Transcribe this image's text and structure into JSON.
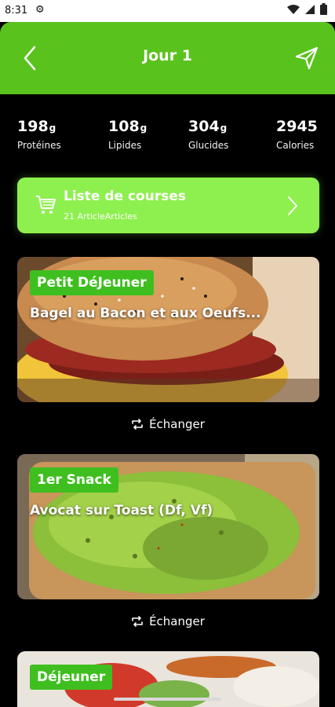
{
  "status": {
    "time": "8:31"
  },
  "header": {
    "title": "Jour 1"
  },
  "macros": [
    {
      "value": "198",
      "unit": "g",
      "label": "Protéines"
    },
    {
      "value": "108",
      "unit": "g",
      "label": "Lipides"
    },
    {
      "value": "304",
      "unit": "g",
      "label": "Glucides"
    },
    {
      "value": "2945",
      "unit": "",
      "label": "Calories"
    }
  ],
  "shopping": {
    "title": "Liste de courses",
    "subtitle": "21 ArticleArticles"
  },
  "meals": [
    {
      "badge": "Petit DéJeuner",
      "name": "Bagel au Bacon et aux Oeufs...",
      "swap": "Échanger"
    },
    {
      "badge": "1er Snack",
      "name": "Avocat sur Toast (Df, Vf)",
      "swap": "Échanger"
    },
    {
      "badge": "Déjeuner"
    }
  ],
  "colors": {
    "accent": "#5ac21d",
    "shopping_bg": "#8ef04f",
    "badge": "#3fbf1f"
  }
}
